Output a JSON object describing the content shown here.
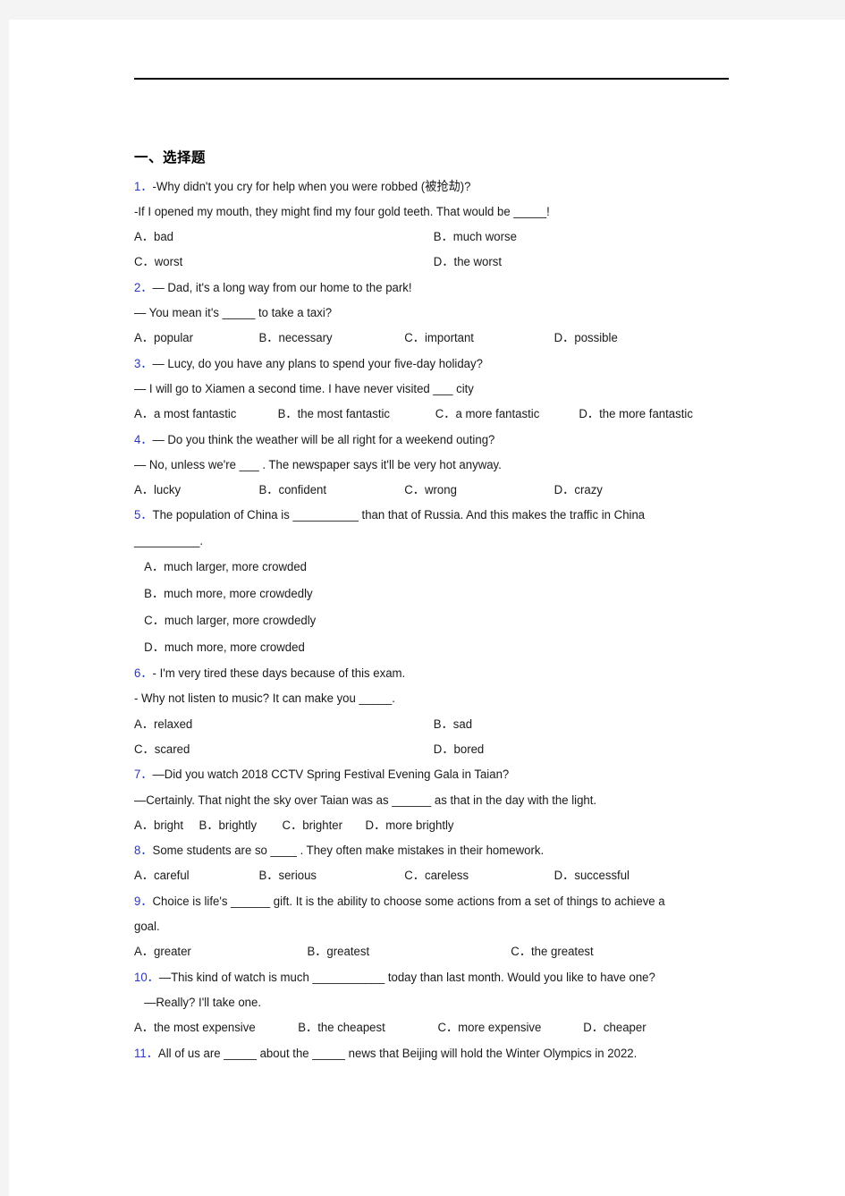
{
  "document": {
    "section_title": "一、选择题"
  },
  "questions": [
    {
      "number": "1．",
      "lines": [
        "-Why didn't you cry for help when you were robbed (被抢劫)?",
        "-If I opened my mouth, they might find my four gold teeth. That would be _____!"
      ],
      "options_rows": [
        [
          "A．bad",
          "B．much worse"
        ],
        [
          "C．worst",
          "D．the worst"
        ]
      ]
    },
    {
      "number": "2．",
      "lines": [
        "— Dad, it's a long way from our home to the park!",
        "— You mean it's _____ to take a taxi?"
      ],
      "options_rows": [
        [
          "A．popular",
          "B．necessary",
          "C．important",
          "D．possible"
        ]
      ]
    },
    {
      "number": "3．",
      "lines": [
        "— Lucy, do you have any plans to spend your five-day holiday?",
        "— I will go to Xiamen a second time. I have never visited ___ city"
      ],
      "options_rows": [
        [
          "A．a most fantastic",
          "B．the most fantastic",
          "C．a more fantastic",
          "D．the more fantastic"
        ]
      ]
    },
    {
      "number": "4．",
      "lines": [
        "— Do you think the weather will be all right for a weekend outing?",
        "— No, unless we're ___ . The newspaper says it'll be very hot anyway."
      ],
      "options_rows": [
        [
          "A．lucky",
          "B．confident",
          "C．wrong",
          "D．crazy"
        ]
      ]
    },
    {
      "number": "5．",
      "lines": [
        "The population of China is __________ than that of Russia. And this makes the traffic in China __________."
      ],
      "options_stacked": [
        "A．much larger, more crowded",
        "B．much more, more crowdedly",
        "C．much larger, more crowdedly",
        "D．much more, more crowded"
      ]
    },
    {
      "number": "6．",
      "lines": [
        "- I'm very tired these days because of this exam.",
        "- Why not listen to music? It can make you _____."
      ],
      "options_rows": [
        [
          "A．relaxed",
          "B．sad"
        ],
        [
          "C．scared",
          "D．bored"
        ]
      ]
    },
    {
      "number": "7．",
      "lines": [
        "—Did you watch 2018 CCTV Spring Festival Evening Gala in Taian?",
        "—Certainly. That night the sky over Taian was as ______ as that in the day with the light."
      ],
      "options_rows": [
        [
          "A．bright",
          "B．brightly",
          "C．brighter",
          "D．more brightly"
        ]
      ]
    },
    {
      "number": "8．",
      "lines": [
        "Some students are so ____ . They often make mistakes in their homework."
      ],
      "options_rows": [
        [
          "A．careful",
          "B．serious",
          "C．careless",
          "D．successful"
        ]
      ]
    },
    {
      "number": "9．",
      "lines": [
        "Choice is life's ______ gift. It is the ability to choose some actions from a set of things to achieve a goal."
      ],
      "options_rows": [
        [
          "A．greater",
          "B．greatest",
          "C．the greatest"
        ]
      ]
    },
    {
      "number": "10．",
      "lines": [
        "—This kind of watch is much ___________ today than last month. Would you like to have one?",
        "—Really? I'll take one."
      ],
      "options_rows": [
        [
          "A．the most expensive",
          "B．the cheapest",
          "C．more expensive",
          "D．cheaper"
        ]
      ]
    },
    {
      "number": "11．",
      "lines": [
        "All of us are _____ about the _____ news that Beijing will hold the Winter Olympics in 2022."
      ],
      "options_rows": []
    }
  ]
}
